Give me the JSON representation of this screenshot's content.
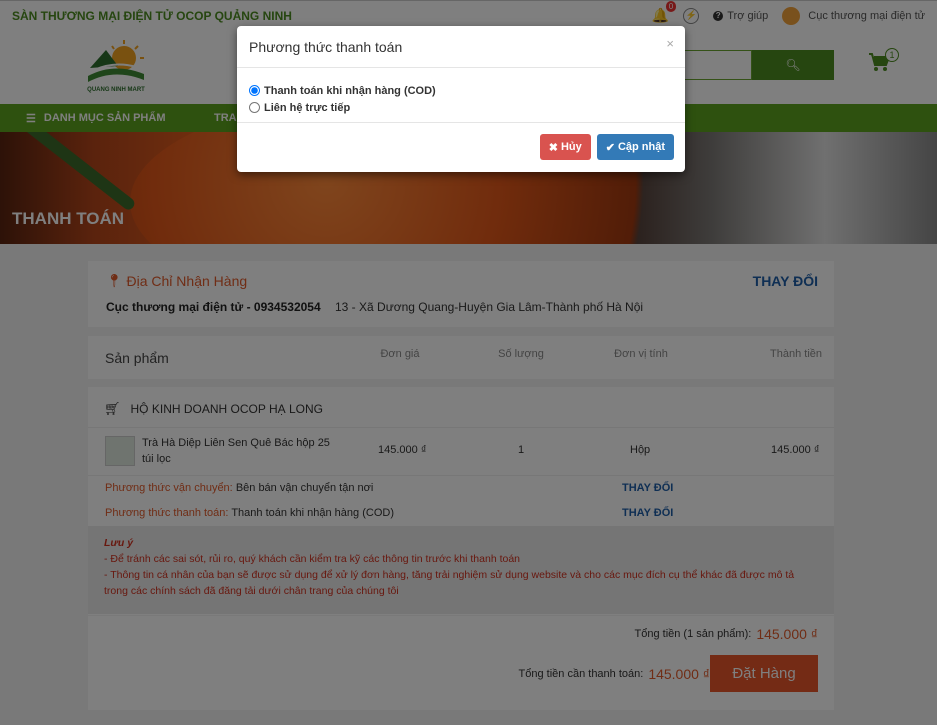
{
  "topbar": {
    "brand": "SÀN THƯƠNG MẠI ĐIỆN TỬ OCOP QUẢNG NINH",
    "bell_count": "0",
    "help": "Trợ giúp",
    "user": "Cục thương mại điện tử"
  },
  "logo": {
    "text": "QUANG NINH MART"
  },
  "cart": {
    "count": "1"
  },
  "nav": {
    "menu": "DANH MỤC SẢN PHẨM",
    "item2": "TRAN"
  },
  "banner": {
    "title": "THANH TOÁN"
  },
  "address": {
    "label": "Địa Chỉ Nhận Hàng",
    "change": "THAY ĐỔI",
    "name": "Cục thương mại điện tử - 0934532054",
    "full": "13 - Xã Dương Quang-Huyện Gia Lâm-Thành phố Hà Nội"
  },
  "table": {
    "product": "Sản phẩm",
    "price": "Đơn giá",
    "qty": "Số lượng",
    "unit": "Đơn vị tính",
    "subtotal": "Thành tiền"
  },
  "shop": {
    "name": "HỘ KINH DOANH OCOP HẠ LONG",
    "item": {
      "name": "Trà Hà Diệp Liên Sen Quê Bác hộp 25 túi lọc",
      "price": "145.000 ₫",
      "qty": "1",
      "unit": "Hộp",
      "subtotal": "145.000 ₫"
    },
    "shipping_key": "Phương thức vận chuyển:",
    "shipping_val": "Bên bán vận chuyển tận nơi",
    "shipping_change": "THAY ĐỔI",
    "payment_key": "Phương thức thanh toán:",
    "payment_val": "Thanh toán khi nhận hàng (COD)",
    "payment_change": "THAY ĐỔI"
  },
  "note": {
    "title": "Lưu ý",
    "line1": "- Để tránh các sai sót, rủi ro, quý khách cần kiểm tra kỹ các thông tin trước khi thanh toán",
    "line2": "- Thông tin cá nhân của bạn sẽ được sử dụng để xử lý đơn hàng, tăng trải nghiệm sử dụng website và cho các mục đích cụ thể khác đã được mô tả trong các chính sách đã đăng tải dưới chân trang của chúng tôi"
  },
  "totals": {
    "sum_label": "Tổng tiền (1 sản phẩm):",
    "sum_value": "145.000 ₫",
    "pay_label": "Tổng tiền cần thanh toán:",
    "pay_value": "145.000 ₫",
    "order_button": "Đặt Hàng"
  },
  "modal": {
    "title": "Phương thức thanh toán",
    "close": "×",
    "option1": "Thanh toán khi nhận hàng (COD)",
    "option2": "Liên hệ trực tiếp",
    "cancel": "Hủy",
    "save": "Cập nhật"
  },
  "colors": {
    "brand_green": "#5da31e",
    "accent_orange": "#e8562a",
    "link_blue": "#1f5fa8"
  }
}
